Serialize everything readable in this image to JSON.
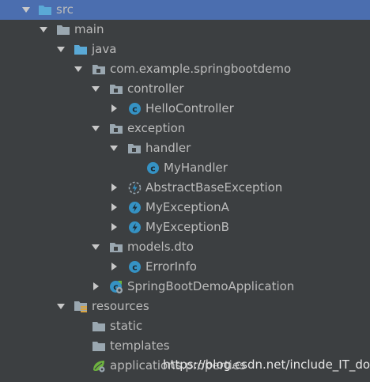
{
  "project_tree": {
    "nodes": [
      {
        "label": "src",
        "icon": "folder-source-root-icon",
        "expanded": true,
        "selected": true
      },
      {
        "label": "main",
        "icon": "folder-icon",
        "expanded": true
      },
      {
        "label": "java",
        "icon": "folder-source-icon",
        "expanded": true
      },
      {
        "label": "com.example.springbootdemo",
        "icon": "package-icon",
        "expanded": true
      },
      {
        "label": "controller",
        "icon": "package-icon",
        "expanded": true
      },
      {
        "label": "HelloController",
        "icon": "class-icon",
        "expanded": false
      },
      {
        "label": "exception",
        "icon": "package-icon",
        "expanded": true
      },
      {
        "label": "handler",
        "icon": "package-icon",
        "expanded": true
      },
      {
        "label": "MyHandler",
        "icon": "class-icon"
      },
      {
        "label": "AbstractBaseException",
        "icon": "abstract-exception-class-icon",
        "expanded": false
      },
      {
        "label": "MyExceptionA",
        "icon": "exception-class-icon",
        "expanded": false
      },
      {
        "label": "MyExceptionB",
        "icon": "exception-class-icon",
        "expanded": false
      },
      {
        "label": "models.dto",
        "icon": "package-icon",
        "expanded": true
      },
      {
        "label": "ErrorInfo",
        "icon": "class-icon",
        "expanded": false
      },
      {
        "label": "SpringBootDemoApplication",
        "icon": "spring-boot-class-icon",
        "expanded": false
      },
      {
        "label": "resources",
        "icon": "resources-folder-icon",
        "expanded": true
      },
      {
        "label": "static",
        "icon": "folder-icon"
      },
      {
        "label": "templates",
        "icon": "folder-icon"
      },
      {
        "label": "applications.properties",
        "icon": "spring-properties-icon"
      }
    ]
  },
  "watermark": "https://blog.csdn.net/include_IT_dog",
  "colors": {
    "background": "#3c3f41",
    "selection": "#4b6eaf",
    "text": "#bbbbbb",
    "folder": "#9aa7b0",
    "source_folder": "#5aa9d6",
    "class_badge": "#3592c4",
    "spring_green": "#6db33f"
  }
}
